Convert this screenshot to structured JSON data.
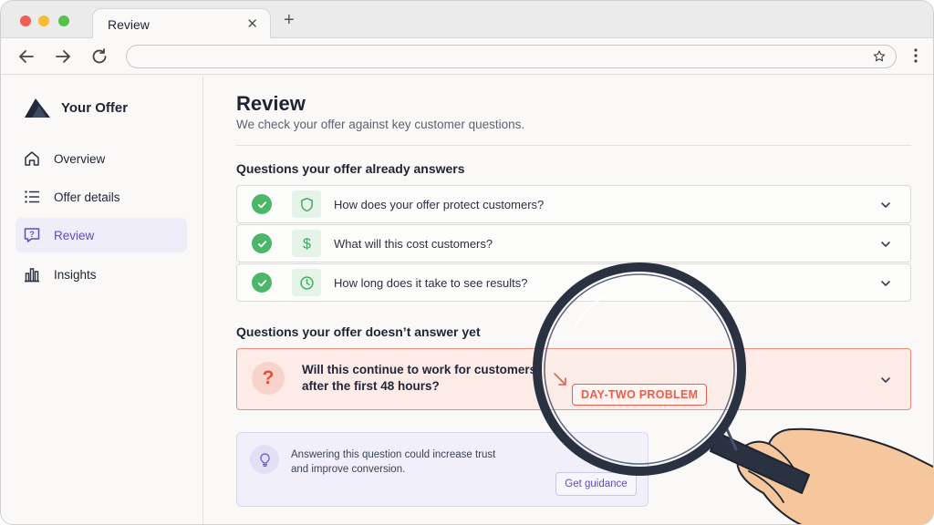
{
  "browser": {
    "tab_title": "Review",
    "tab_close": "✕",
    "new_tab": "+"
  },
  "sidebar": {
    "brand": "Your Offer",
    "items": [
      {
        "label": "Overview",
        "icon": "home-icon",
        "active": false
      },
      {
        "label": "Offer details",
        "icon": "list-icon",
        "active": false
      },
      {
        "label": "Review",
        "icon": "question-bubble-icon",
        "active": true
      },
      {
        "label": "Insights",
        "icon": "bar-chart-icon",
        "active": false
      }
    ]
  },
  "main": {
    "title": "Review",
    "subtitle": "We check your offer against key customer questions.",
    "answered_heading": "Questions your offer already answers",
    "answered": [
      {
        "text": "How does your offer protect customers?",
        "icon": "shield-icon"
      },
      {
        "text": "What will this cost customers?",
        "icon": "dollar-icon"
      },
      {
        "text": "How long does it take to see results?",
        "icon": "clock-icon"
      }
    ],
    "unanswered_heading": "Questions your offer doesn’t answer yet",
    "unanswered": {
      "mark": "?",
      "text": "Will this continue to work for customers after the first 48 hours?",
      "tag": "DAY-TWO PROBLEM"
    },
    "tip": {
      "text": "Answering this question could increase trust and improve conversion.",
      "button": "Get guidance",
      "icon": "lightbulb-icon"
    }
  },
  "colors": {
    "accent": "#5b4fbd",
    "success": "#4cb669",
    "warning": "#e2533d",
    "warning_bg": "#fcebe7",
    "magnifier_rim": "#2a3140",
    "hand": "#f6c79c"
  }
}
